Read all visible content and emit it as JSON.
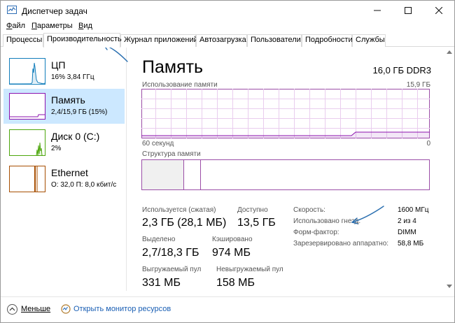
{
  "window": {
    "title": "Диспетчер задач"
  },
  "menu": [
    {
      "access": "Ф",
      "rest": "айл"
    },
    {
      "access": "П",
      "rest": "араметры"
    },
    {
      "access": "В",
      "rest": "ид"
    }
  ],
  "tabs": [
    {
      "label": "Процессы",
      "active": false
    },
    {
      "label": "Производительность",
      "active": true
    },
    {
      "label": "Журнал приложений",
      "active": false
    },
    {
      "label": "Автозагрузка",
      "active": false
    },
    {
      "label": "Пользователи",
      "active": false
    },
    {
      "label": "Подробности",
      "active": false
    },
    {
      "label": "Службы",
      "active": false
    }
  ],
  "sidebar": {
    "items": [
      {
        "title": "ЦП",
        "sub": "16% 3,84 ГГц",
        "color": "#117dbb",
        "selected": false
      },
      {
        "title": "Память",
        "sub": "2,4/15,9 ГБ (15%)",
        "color": "#8b12ae",
        "selected": true
      },
      {
        "title": "Диск 0 (C:)",
        "sub": "2%",
        "color": "#4da60c",
        "selected": false
      },
      {
        "title": "Ethernet",
        "sub": "О: 32,0 П: 8,0 кбит/с",
        "color": "#a74f01",
        "selected": false
      }
    ]
  },
  "main": {
    "title": "Память",
    "hardware": "16,0 ГБ DDR3",
    "usage_label": "Использование памяти",
    "usage_max": "15,9 ГБ",
    "axis_left": "60 секунд",
    "axis_right": "0",
    "structure_label": "Структура памяти",
    "usage_fraction": 0.15,
    "stats": {
      "in_use_label": "Используется (сжатая)",
      "in_use_value": "2,3 ГБ (28,1 МБ)",
      "available_label": "Доступно",
      "available_value": "13,5 ГБ",
      "committed_label": "Выделено",
      "committed_value": "2,7/18,3 ГБ",
      "cached_label": "Кэшировано",
      "cached_value": "974 МБ",
      "paged_label": "Выгружаемый пул",
      "paged_value": "331 МБ",
      "nonpaged_label": "Невыгружаемый пул",
      "nonpaged_value": "158 МБ"
    },
    "kv": [
      {
        "label": "Скорость:",
        "value": "1600 МГц"
      },
      {
        "label": "Использовано гнезд:",
        "value": "2 из 4"
      },
      {
        "label": "Форм-фактор:",
        "value": "DIMM"
      },
      {
        "label": "Зарезервировано аппаратно:",
        "value": "58,8 МБ"
      }
    ]
  },
  "footer": {
    "less_label": "Меньше",
    "monitor_label": "Открыть монитор ресурсов"
  },
  "colors": {
    "memory": "#8b12ae",
    "annotation": "#2a6fb0",
    "selection": "#cce8ff"
  }
}
